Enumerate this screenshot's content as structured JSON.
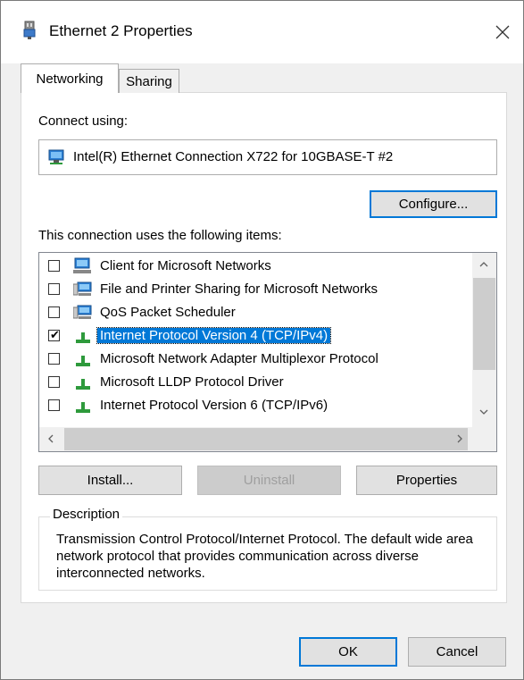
{
  "window": {
    "title": "Ethernet 2 Properties",
    "icons": {
      "title": "network-adapter-icon",
      "close": "close-icon"
    }
  },
  "tabs": [
    {
      "label": "Networking",
      "active": true
    },
    {
      "label": "Sharing",
      "active": false
    }
  ],
  "connect_using": {
    "label": "Connect using:",
    "adapter": "Intel(R) Ethernet Connection X722 for 10GBASE-T #2",
    "configure_button": "Configure..."
  },
  "items_section": {
    "label": "This connection uses the following items:",
    "items": [
      {
        "label": "Client for Microsoft Networks",
        "checked": false,
        "selected": false,
        "icon": "client-network-icon"
      },
      {
        "label": "File and Printer Sharing for Microsoft Networks",
        "checked": false,
        "selected": false,
        "icon": "service-network-icon"
      },
      {
        "label": "QoS Packet Scheduler",
        "checked": false,
        "selected": false,
        "icon": "service-network-icon"
      },
      {
        "label": "Internet Protocol Version 4 (TCP/IPv4)",
        "checked": true,
        "selected": true,
        "icon": "protocol-icon"
      },
      {
        "label": "Microsoft Network Adapter Multiplexor Protocol",
        "checked": false,
        "selected": false,
        "icon": "protocol-icon"
      },
      {
        "label": "Microsoft LLDP Protocol Driver",
        "checked": false,
        "selected": false,
        "icon": "protocol-icon"
      },
      {
        "label": "Internet Protocol Version 6 (TCP/IPv6)",
        "checked": false,
        "selected": false,
        "icon": "protocol-icon"
      }
    ]
  },
  "buttons": {
    "install": "Install...",
    "uninstall": "Uninstall",
    "properties": "Properties",
    "ok": "OK",
    "cancel": "Cancel"
  },
  "description": {
    "legend": "Description",
    "text": "Transmission Control Protocol/Internet Protocol. The default wide area network protocol that provides communication across diverse interconnected networks."
  },
  "colors": {
    "selection": "#0078d7",
    "default_button_border": "#0078d7"
  }
}
